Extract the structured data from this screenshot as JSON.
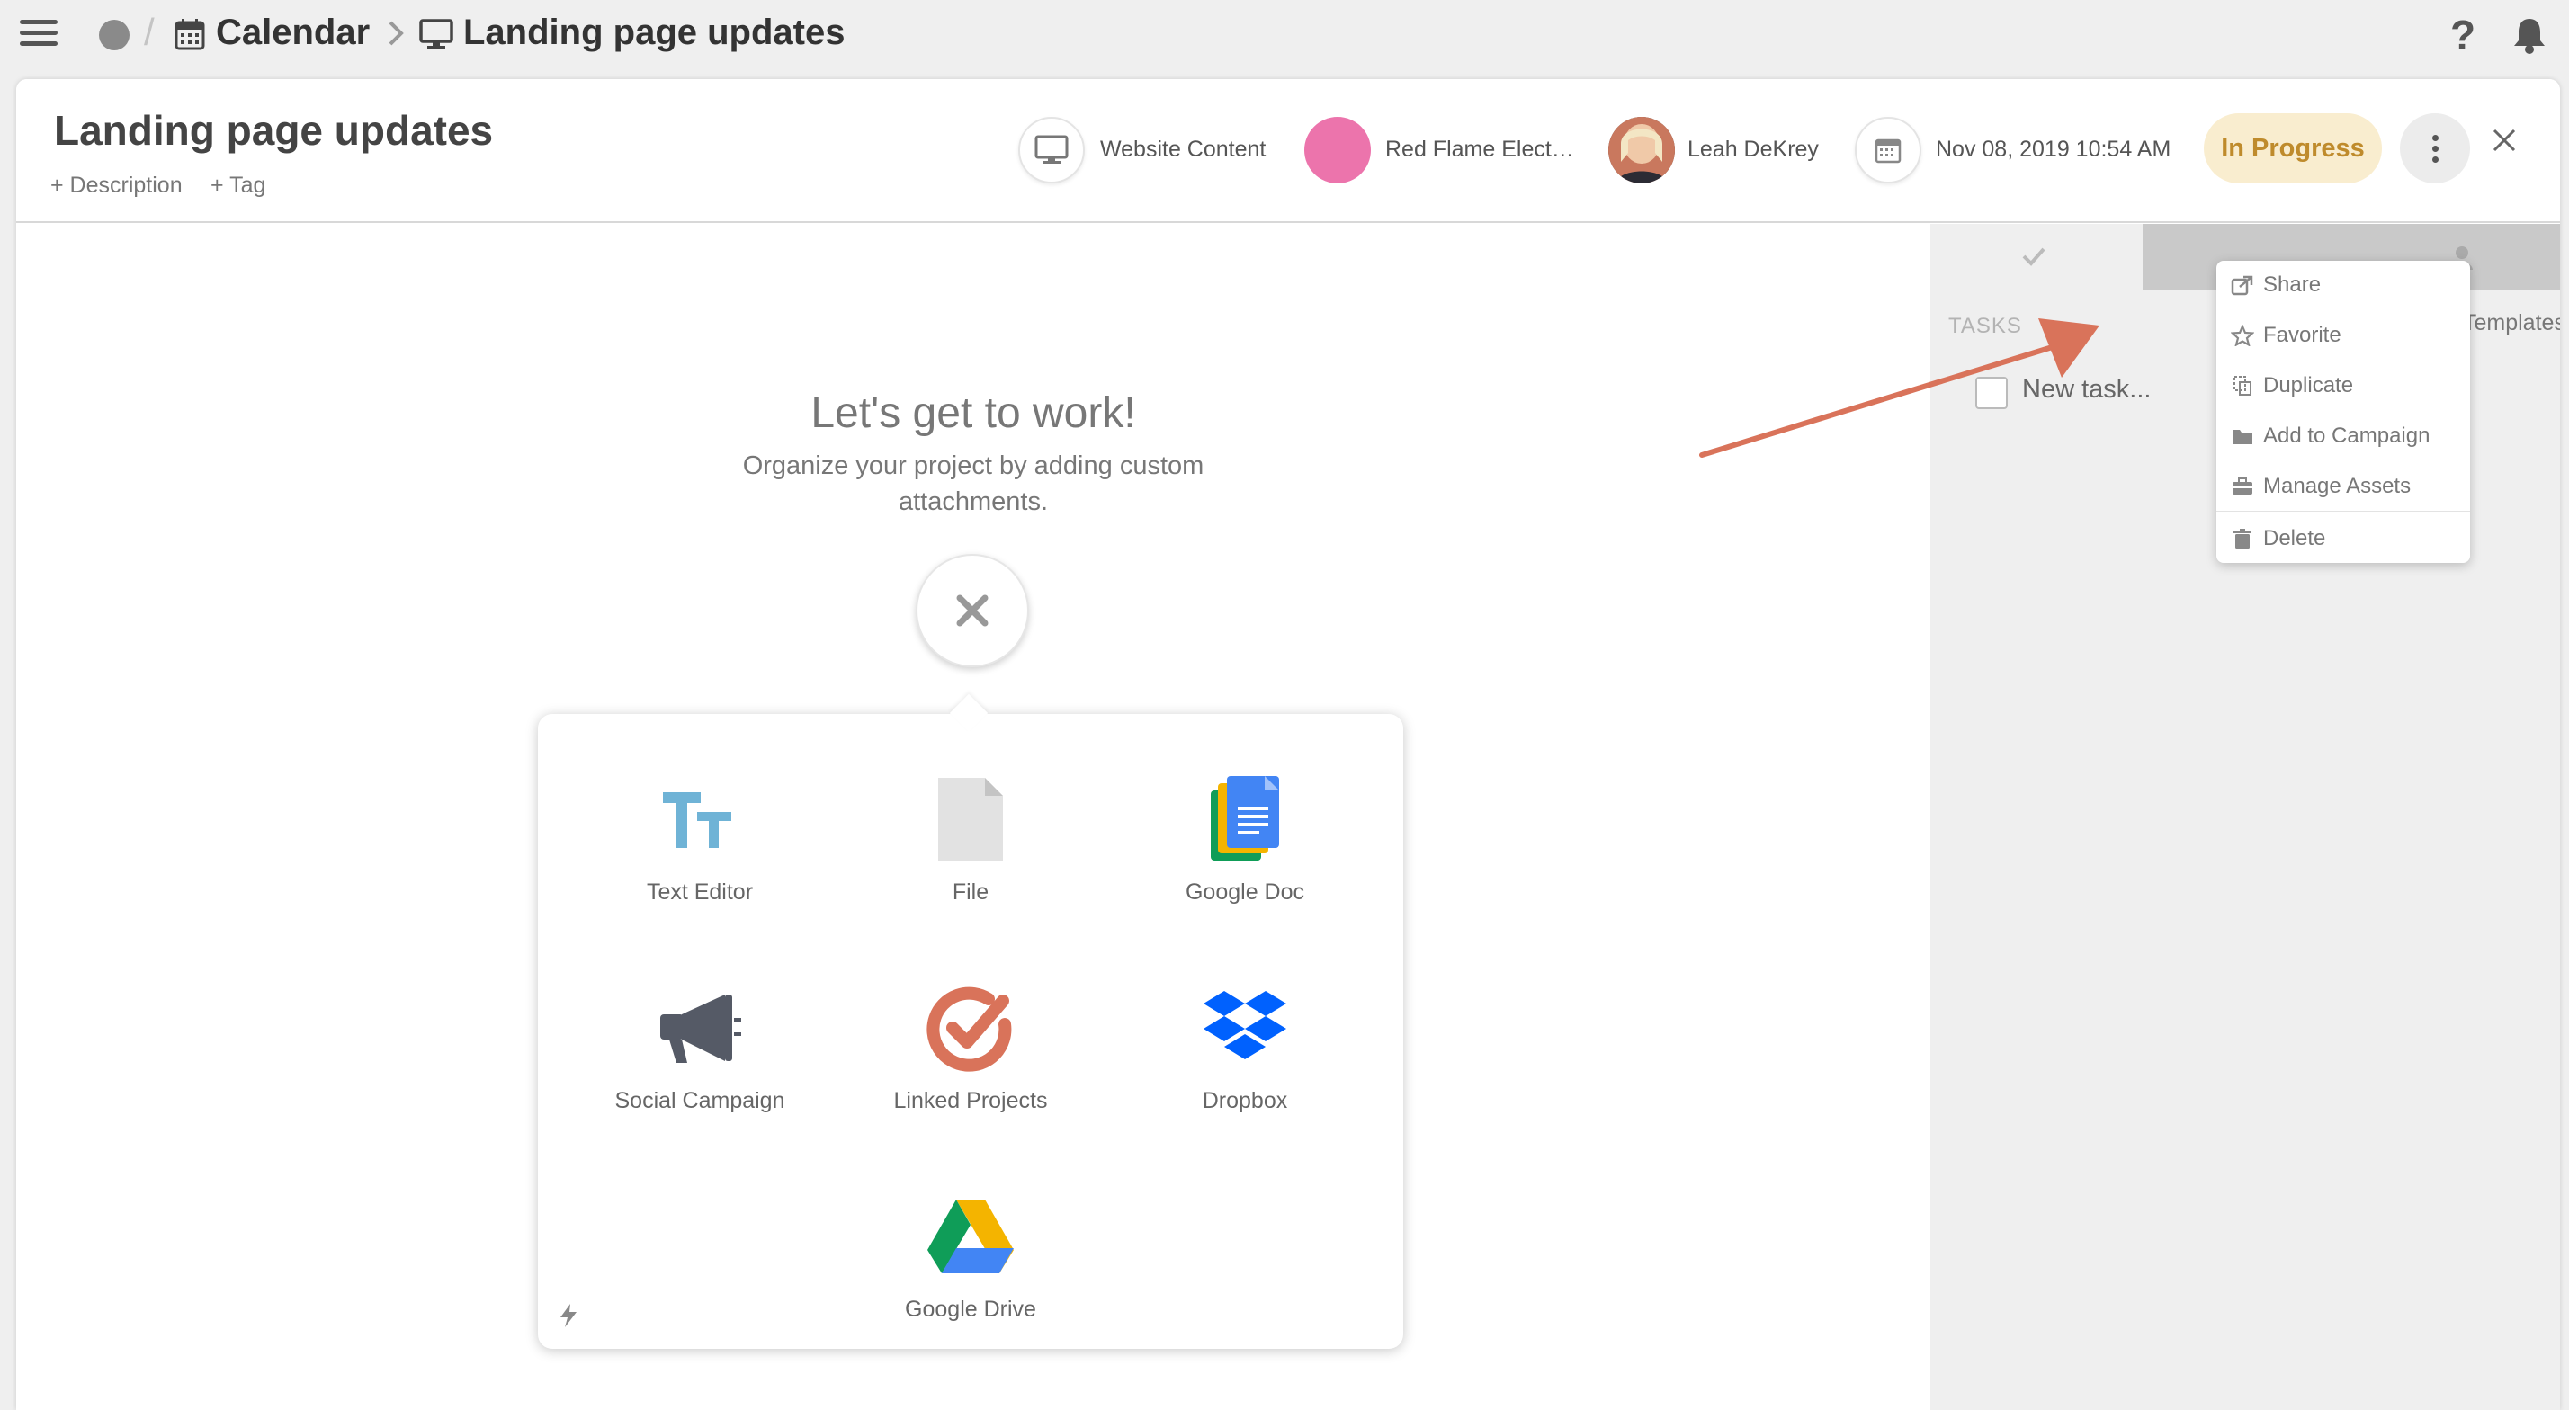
{
  "breadcrumb": {
    "calendar_label": "Calendar",
    "page_label": "Landing page updates"
  },
  "project": {
    "title": "Landing page updates",
    "add_description": "+ Description",
    "add_tag": "+ Tag",
    "content_type": "Website Content",
    "client": "Red Flame Elect…",
    "assignee": "Leah DeKrey",
    "due_date": "Nov 08, 2019 10:54 AM",
    "status": "In Progress"
  },
  "colors": {
    "status_bg": "#f9edcf",
    "status_text": "#bf8b2c",
    "client_dot": "#ec74ac",
    "annotation_arrow": "#d9735a"
  },
  "empty_state": {
    "title": "Let's get to work!",
    "subtitle": "Organize your project by adding custom attachments."
  },
  "attachments": [
    {
      "label": "Text Editor",
      "icon": "text-editor-icon"
    },
    {
      "label": "File",
      "icon": "file-icon"
    },
    {
      "label": "Google Doc",
      "icon": "google-doc-icon"
    },
    {
      "label": "Social Campaign",
      "icon": "megaphone-icon"
    },
    {
      "label": "Linked Projects",
      "icon": "linked-projects-icon"
    },
    {
      "label": "Dropbox",
      "icon": "dropbox-icon"
    },
    {
      "label": "Google Drive",
      "icon": "google-drive-icon"
    }
  ],
  "right_panel": {
    "tasks_label": "TASKS",
    "templates_label": "Templates",
    "new_task_placeholder": "New task..."
  },
  "menu": {
    "items": [
      {
        "label": "Share",
        "icon": "share-icon"
      },
      {
        "label": "Favorite",
        "icon": "star-icon"
      },
      {
        "label": "Duplicate",
        "icon": "duplicate-icon"
      },
      {
        "label": "Add to Campaign",
        "icon": "folder-icon"
      },
      {
        "label": "Manage Assets",
        "icon": "briefcase-icon"
      },
      {
        "label": "Delete",
        "icon": "trash-icon"
      }
    ]
  }
}
